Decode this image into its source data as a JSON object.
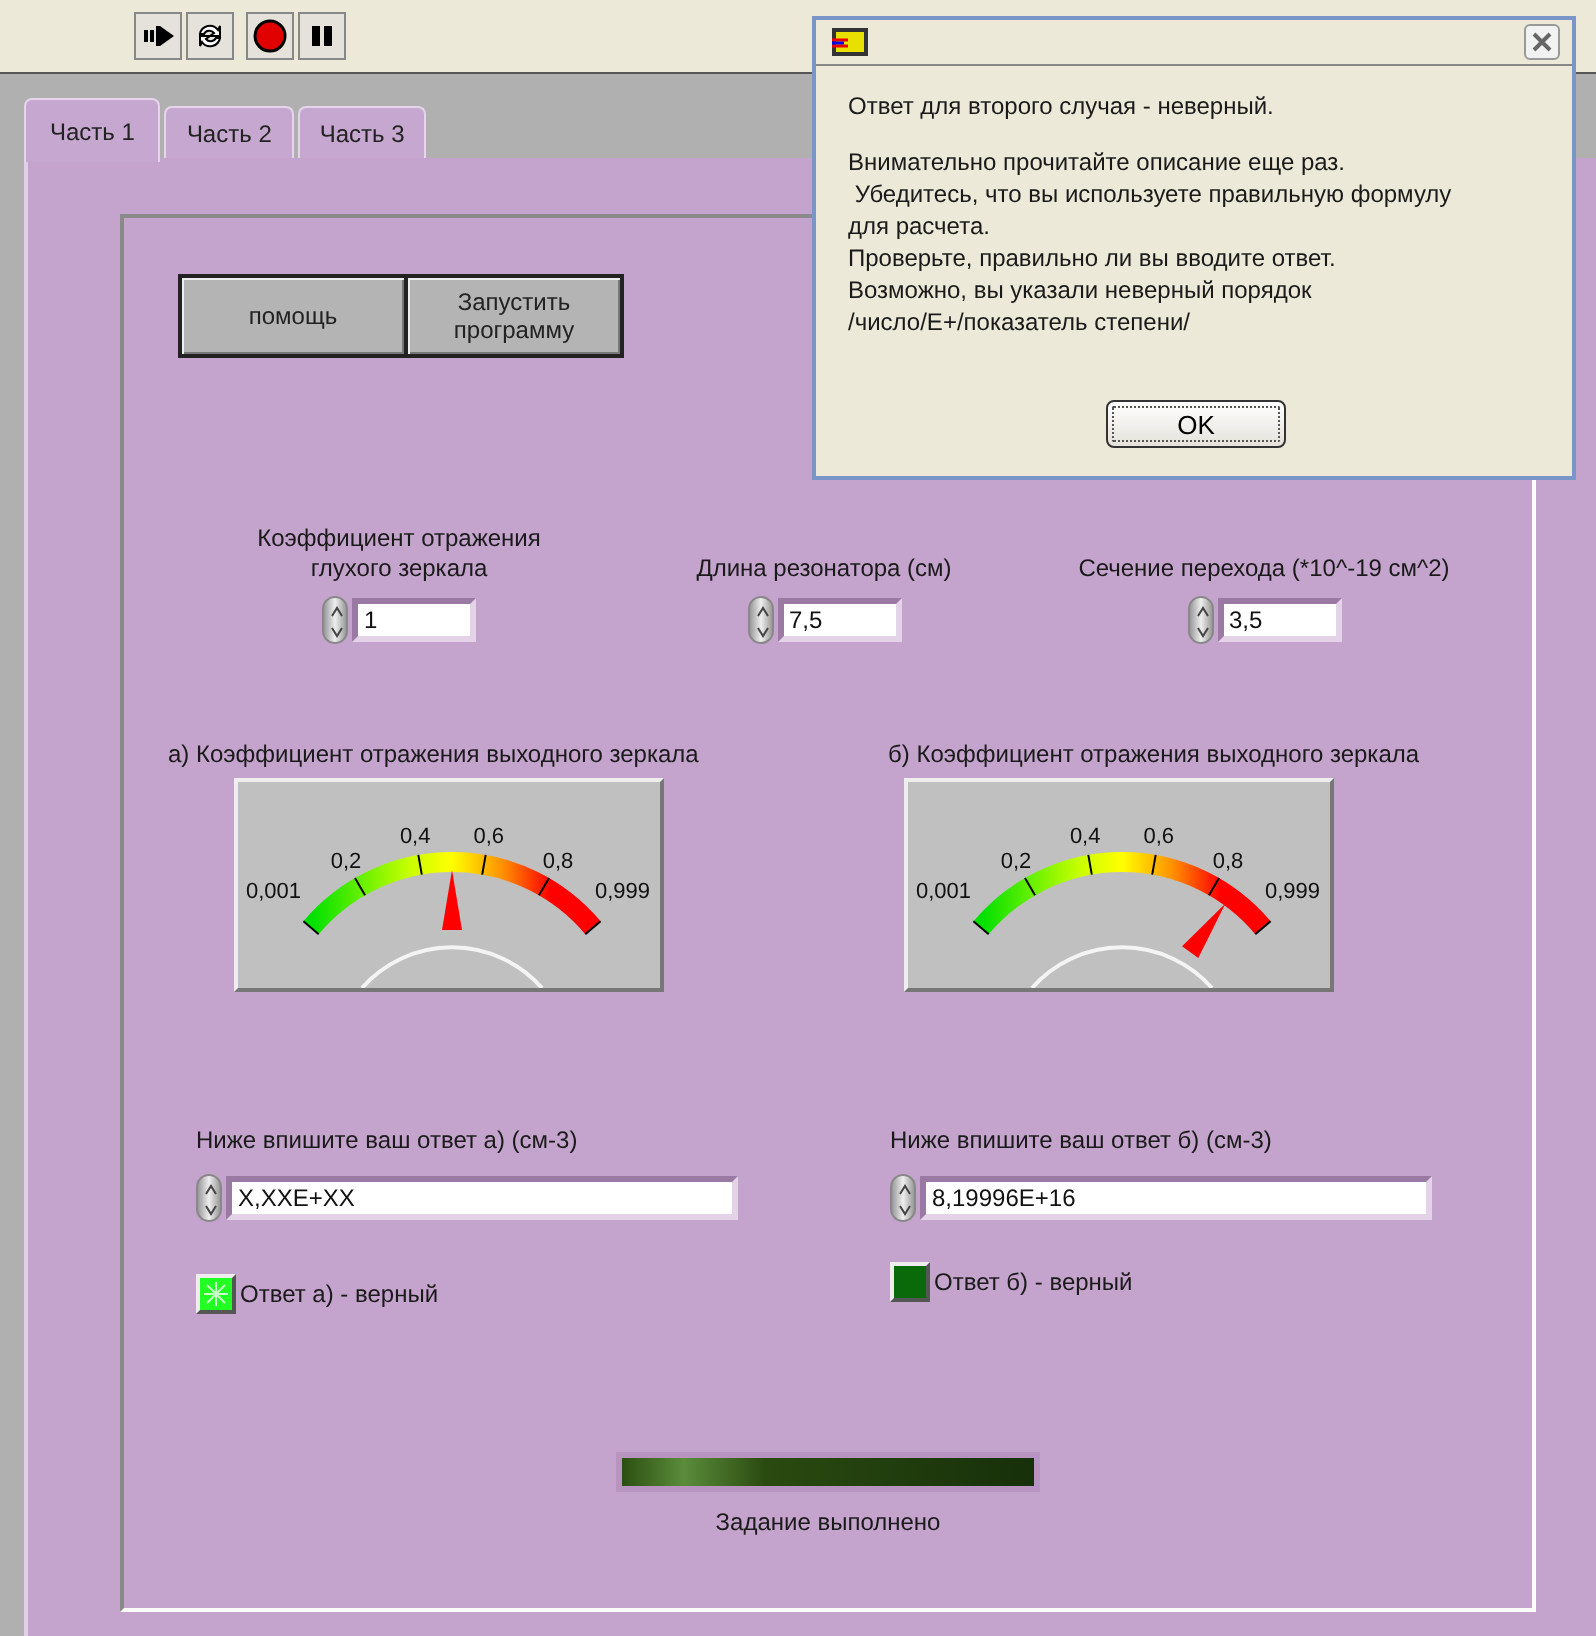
{
  "toolbar": [
    {
      "kind": "run"
    },
    {
      "kind": "run-continuous"
    },
    {
      "kind": "abort"
    },
    {
      "kind": "pause"
    }
  ],
  "tabs": [
    {
      "label": "Часть 1",
      "selected": true
    },
    {
      "label": "Часть 2",
      "selected": false
    },
    {
      "label": "Часть 3",
      "selected": false
    }
  ],
  "buttons": [
    "помощь",
    "Запустить программу"
  ],
  "inputs": [
    {
      "label": "Коэффициент отражения глухого зеркала",
      "value": "1"
    },
    {
      "label": "Длина резонатора (см)",
      "value": "7,5"
    },
    {
      "label": "Сечение перехода (*10^-19 см^2)",
      "value": "3,5"
    }
  ],
  "gauges": [
    {
      "title": "а) Коэффициент отражения выходного зеркала",
      "scale": [
        "0,001",
        "0,2",
        "0,4",
        "0,6",
        "0,8",
        "0,999"
      ]
    },
    {
      "title": "б) Коэффициент отражения выходного зеркала",
      "scale": [
        "0,001",
        "0,2",
        "0,4",
        "0,6",
        "0,8",
        "0,999"
      ]
    }
  ],
  "answers": [
    {
      "label": "Ниже впишите ваш ответ а) (см-3)",
      "value": "X,XXE+XX",
      "indicator": {
        "label": "Ответ а) - верный",
        "on": true
      }
    },
    {
      "label": "Ниже впишите ваш ответ б) (см-3)",
      "value": "8,19996E+16",
      "indicator": {
        "label": "Ответ б) - верный",
        "on": false
      }
    }
  ],
  "status": {
    "label": "Задание выполнено",
    "on": false
  },
  "dialog": {
    "paragraphs": [
      {
        "lines": [
          "Ответ для второго случая - неверный."
        ]
      },
      {
        "lines": [
          "Внимательно прочитайте описание еще раз.",
          " Убедитесь, что вы используете правильную формулу",
          "для расчета.",
          "Проверьте, правильно ли вы вводите ответ.",
          "Возможно, вы указали неверный порядок",
          "/число/Е+/показатель степени/"
        ]
      }
    ],
    "button": "OK"
  }
}
